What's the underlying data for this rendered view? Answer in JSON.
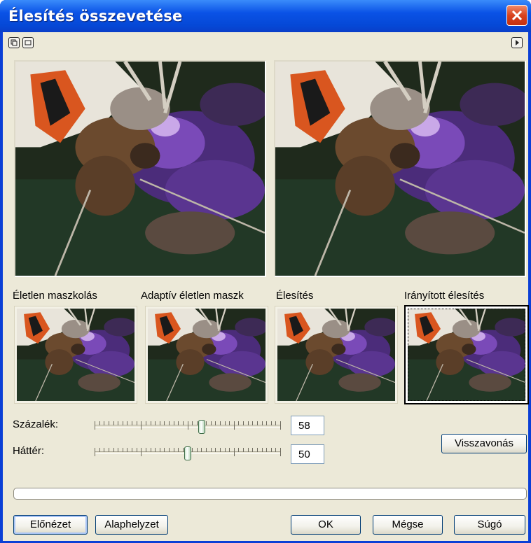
{
  "window": {
    "title": "Élesítés összevetése"
  },
  "toolbar": {
    "icons": [
      "view-split-icon",
      "view-single-icon",
      "play-icon"
    ]
  },
  "methods": [
    {
      "label": "Életlen maszkolás",
      "selected": false
    },
    {
      "label": "Adaptív életlen maszk",
      "selected": false
    },
    {
      "label": "Élesítés",
      "selected": false
    },
    {
      "label": "Irányított élesítés",
      "selected": true
    }
  ],
  "controls": {
    "percent": {
      "label": "Százalék:",
      "value": "58",
      "level": 58
    },
    "background": {
      "label": "Háttér:",
      "value": "50",
      "level": 50
    },
    "undo_label": "Visszavonás"
  },
  "progress": {
    "value": 0
  },
  "buttons": {
    "preview": "Előnézet",
    "default": "Alaphelyzet",
    "ok": "OK",
    "cancel": "Mégse",
    "help": "Súgó"
  },
  "colors": {
    "title_bar": "#0a52e6",
    "face": "#ece9d8",
    "close": "#d8421e"
  }
}
